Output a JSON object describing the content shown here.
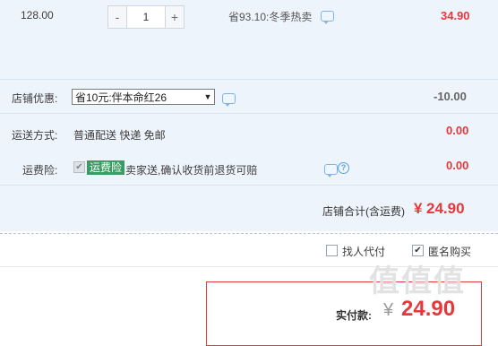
{
  "item": {
    "unit_price": "128.00",
    "quantity": "1",
    "decrement_symbol": "-",
    "increment_symbol": "+",
    "promo_text": "省93.10:冬季热卖",
    "subtotal": "34.90"
  },
  "shop_discount": {
    "label": "店铺优惠:",
    "selected_option": "省10元:伴本命红26",
    "amount": "-10.00"
  },
  "shipping": {
    "label": "运送方式:",
    "method": "普通配送 快递 免邮",
    "amount": "0.00"
  },
  "shipping_insurance": {
    "label": "运费险:",
    "tag": "运费险",
    "description": "卖家送,确认收货前退货可赔",
    "amount": "0.00"
  },
  "store_total": {
    "label": "店铺合计(含运费)",
    "currency": "¥",
    "amount": "24.90"
  },
  "options": {
    "pay_for_me": "找人代付",
    "anonymous": "匿名购买"
  },
  "payment": {
    "label": "实付款:",
    "currency": "¥",
    "amount": "24.90"
  },
  "watermark": "值值值",
  "colors": {
    "accent_red": "#e4393c",
    "panel_bg": "#eef4fb",
    "insurance_green": "#3a9c63"
  },
  "icons": {
    "message": "message-bubble-icon",
    "help": "question-circle-icon",
    "check": "checkmark-icon"
  }
}
